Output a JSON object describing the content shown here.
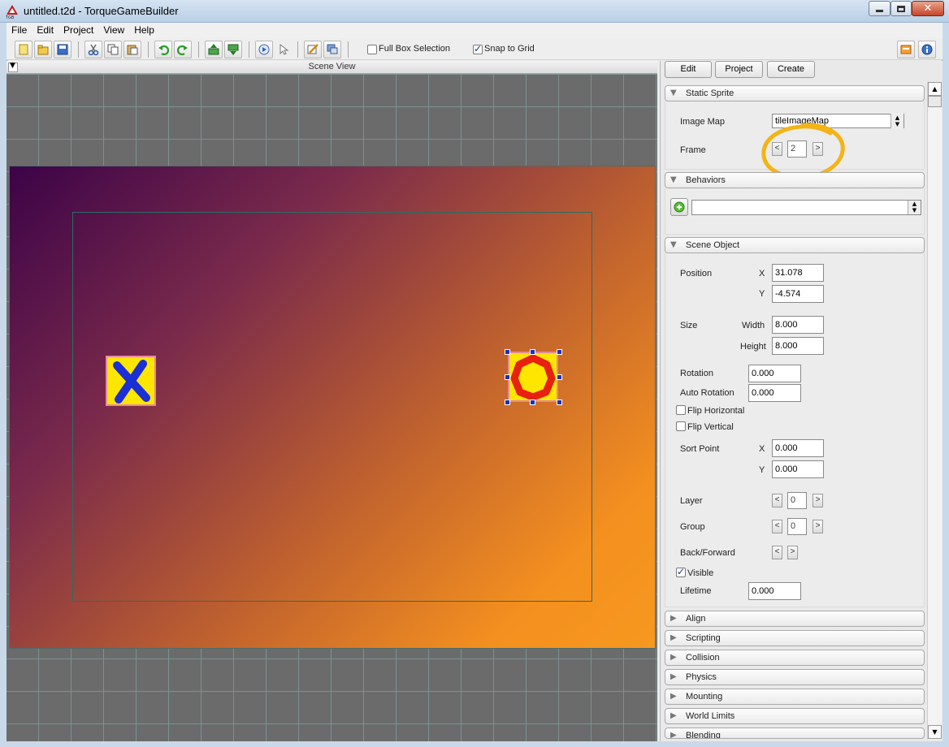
{
  "window": {
    "title": "untitled.t2d - TorqueGameBuilder",
    "app_icon_text": "TGB"
  },
  "menu": [
    "File",
    "Edit",
    "Project",
    "View",
    "Help"
  ],
  "toolbar": {
    "full_box_selection_label": "Full Box Selection",
    "full_box_selection_checked": false,
    "snap_to_grid_label": "Snap to Grid",
    "snap_to_grid_checked": true
  },
  "scene_view": {
    "header": "Scene View"
  },
  "sprites": [
    {
      "name": "x-tile",
      "glyph": "X",
      "color": "#1b2fd6",
      "selected": false
    },
    {
      "name": "o-tile",
      "glyph": "O",
      "color": "#e8200f",
      "selected": true
    }
  ],
  "tabs": [
    "Edit",
    "Project",
    "Create"
  ],
  "static_sprite": {
    "title": "Static Sprite",
    "image_map_label": "Image Map",
    "image_map_value": "tileImageMap",
    "frame_label": "Frame",
    "frame_value": "2"
  },
  "behaviors": {
    "title": "Behaviors",
    "selected": ""
  },
  "scene_object": {
    "title": "Scene Object",
    "position_label": "Position",
    "x_label": "X",
    "y_label": "Y",
    "position_x": "31.078",
    "position_y": "-4.574",
    "size_label": "Size",
    "width_label": "Width",
    "height_label": "Height",
    "width": "8.000",
    "height": "8.000",
    "rotation_label": "Rotation",
    "rotation": "0.000",
    "auto_rotation_label": "Auto Rotation",
    "auto_rotation": "0.000",
    "flip_horizontal_label": "Flip Horizontal",
    "flip_vertical_label": "Flip Vertical",
    "sort_point_label": "Sort Point",
    "sort_x": "0.000",
    "sort_y": "0.000",
    "layer_label": "Layer",
    "layer": "0",
    "group_label": "Group",
    "group": "0",
    "back_forward_label": "Back/Forward",
    "visible_label": "Visible",
    "visible_checked": true,
    "lifetime_label": "Lifetime",
    "lifetime": "0.000"
  },
  "collapsed_sections": [
    "Align",
    "Scripting",
    "Collision",
    "Physics",
    "Mounting",
    "World Limits",
    "Blending"
  ],
  "colors": {
    "annotation_circle": "#f3b415",
    "grid_line": "#7a9291",
    "selection_handle": "#1e2fb8"
  }
}
